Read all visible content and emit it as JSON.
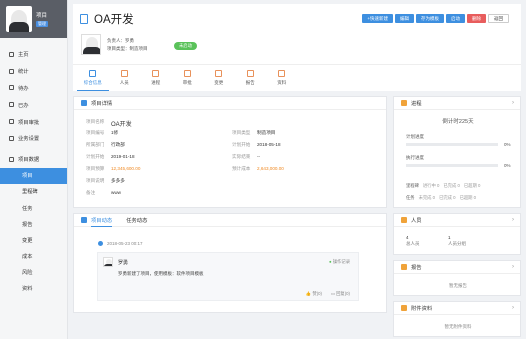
{
  "sidebar": {
    "project_title": "项目",
    "project_badge": "管理",
    "nav": [
      "主页",
      "统计",
      "待办",
      "已办",
      "项目审批",
      "业务设置",
      "项目数据"
    ],
    "sub": [
      "项目",
      "里程碑",
      "任务",
      "报告",
      "变更",
      "成本",
      "风险",
      "资料"
    ]
  },
  "header": {
    "title": "OA开发",
    "buttons": [
      "+快速新建",
      "编辑",
      "存为模板",
      "启动",
      "删除",
      "返回"
    ],
    "owner_label": "负责人：罗勇",
    "type_label": "项目类型：制造项目",
    "status": "未启动"
  },
  "tabs": [
    "综合信息",
    "人员",
    "进程",
    "审批",
    "变更",
    "报告",
    "资料"
  ],
  "details": {
    "title": "项目详情",
    "rows": [
      {
        "k": "项目名称",
        "v": "OA开发"
      },
      {
        "k": "项目编号",
        "v": "1修"
      },
      {
        "k": "所属部门",
        "v": "行政部"
      },
      {
        "k": "计划开始",
        "v": "2019-01-18"
      },
      {
        "k": "项目预算",
        "v": "12,345,600.00"
      },
      {
        "k": "项目说明",
        "v": "多多多"
      },
      {
        "k": "备注",
        "v": "www"
      }
    ],
    "rows_right": [
      {
        "k": "项目类型",
        "v": "制造项目"
      },
      {
        "k": "项目类型",
        "v": "2018-05-18"
      },
      {
        "k": "实际结束",
        "v": "--"
      },
      {
        "k": "预计成本",
        "v": "2,643,000.00"
      }
    ],
    "rows_right_keys": [
      "项目类型",
      "计划开始",
      "实际结束",
      "预计成本"
    ]
  },
  "feed": {
    "tabs": [
      "项目动态",
      "任务动态"
    ],
    "date": "2018-05-23 00:17",
    "user": "罗勇",
    "tag": "操作记录",
    "text": "罗勇新建了项目，使用模板：软件项目模板",
    "like": "赞(0)",
    "reply": "回复(0)"
  },
  "progress": {
    "title": "进程",
    "countdown": "倒计时225天",
    "plan_label": "计划进度",
    "plan_pct": "0%",
    "actual_label": "执行进度",
    "actual_pct": "0%",
    "milestone": {
      "label": "里程碑",
      "ongoing": "进行中 0",
      "done": "已完成 0",
      "delay": "已超期 0"
    },
    "task": {
      "label": "任务",
      "ongoing": "未完成 0",
      "done": "已完成 0",
      "delay": "已超期 0"
    },
    "plan_value": 0,
    "actual_value": 0
  },
  "people": {
    "title": "人员",
    "total_num": "4",
    "total_label": "总人员",
    "group_num": "1",
    "group_label": "人员分组"
  },
  "report": {
    "title": "报告",
    "empty": "暂无报告"
  },
  "attachments": {
    "title": "附件资料",
    "empty": "暂无附件资料"
  },
  "colors": {
    "accent": "#3d8fe0",
    "danger": "#e85d5d",
    "success": "#5ac25a",
    "money": "#f08a24"
  }
}
